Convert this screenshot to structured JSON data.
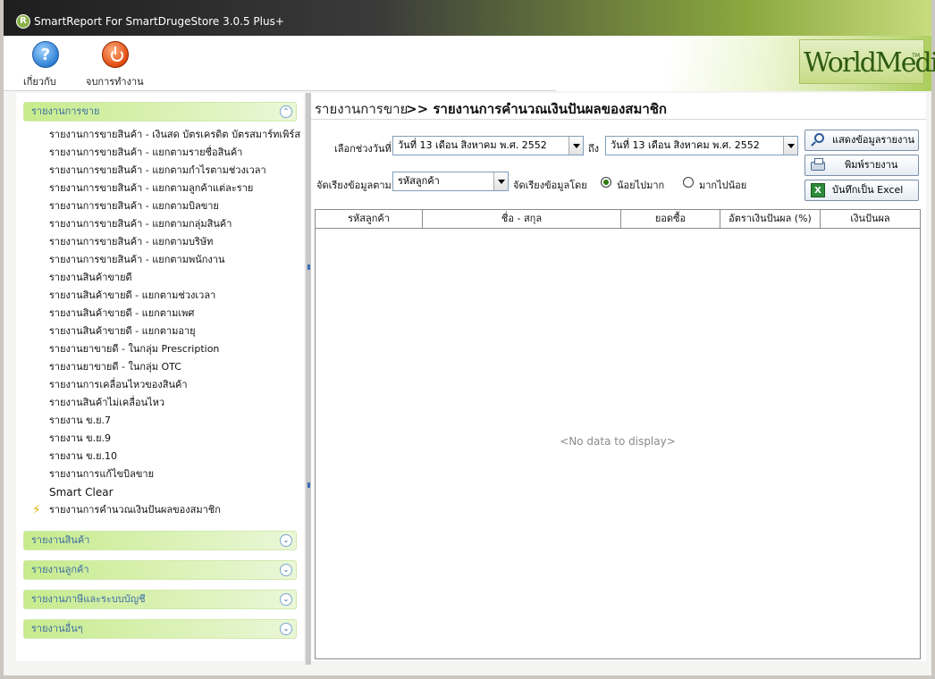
{
  "window": {
    "title": "SmartReport For SmartDrugeStore 3.0.5 Plus+",
    "app_icon": "R"
  },
  "toolbar": {
    "about_label": "เกี่ยวกับ",
    "exit_label": "จบการทำงาน",
    "brand": "WorldMedic",
    "brand_tm": "TM"
  },
  "sidebar": {
    "sales_group": "รายงานการขาย",
    "items": [
      "รายงานการขายสินค้า - เงินสด บัตรเครดิต บัตรสมาร์ทเพิร์ส",
      "รายงานการขายสินค้า - แยกตามรายชื่อสินค้า",
      "รายงานการขายสินค้า - แยกตามกำไรตามช่วงเวลา",
      "รายงานการขายสินค้า - แยกตามลูกค้าแต่ละราย",
      "รายงานการขายสินค้า - แยกตามบิลขาย",
      "รายงานการขายสินค้า - แยกตามกลุ่มสินค้า",
      "รายงานการขายสินค้า - แยกตามบริษัท",
      "รายงานการขายสินค้า - แยกตามพนักงาน",
      "รายงานสินค้าขายดี",
      "รายงานสินค้าขายดี - แยกตามช่วงเวลา",
      "รายงานสินค้าขายดี - แยกตามเพศ",
      "รายงานสินค้าขายดี - แยกตามอายุ",
      "รายงานยาขายดี - ในกลุ่ม Prescription",
      "รายงานยาขายดี - ในกลุ่ม OTC",
      "รายงานการเคลื่อนไหวของสินค้า",
      "รายงานสินค้าไม่เคลื่อนไหว",
      "รายงาน ข.ย.7",
      "รายงาน ข.ย.9",
      "รายงาน ข.ย.10",
      "รายงานการแก้ไขบิลขาย",
      "Smart Clear",
      "รายงานการคำนวณเงินปันผลของสมาชิก"
    ],
    "other_groups": [
      "รายงานสินค้า",
      "รายงานลูกค้า",
      "รายงานภาษีและระบบบัญชี",
      "รายงานอื่นๆ"
    ]
  },
  "main": {
    "breadcrumb_parent": "รายงานการขาย",
    "breadcrumb_current": ">> รายงานการคำนวณเงินปันผลของสมาชิก",
    "filters": {
      "date_range_label": "เลือกช่วงวันที่",
      "date_from": "วันที่ 13 เดือน  สิงหาคม  พ.ศ.  2552",
      "to_label": "ถึง",
      "date_to": "วันที่ 13 เดือน  สิงหาคม  พ.ศ.  2552",
      "sort_field_label": "จัดเรียงข้อมูลตาม",
      "sort_field": "รหัสลูกค้า",
      "sort_order_label": "จัดเรียงข้อมูลโดย",
      "asc_label": "น้อยไปมาก",
      "desc_label": "มากไปน้อย"
    },
    "buttons": {
      "show_report": "แสดงข้อมูลรายงาน",
      "print_report": "พิมพ์รายงาน",
      "save_excel": "บันทึกเป็น Excel"
    },
    "grid": {
      "columns": [
        "รหัสลูกค้า",
        "ชื่อ - สกุล",
        "ยอดซื้อ",
        "อัตราเงินปันผล (%)",
        "เงินปันผล"
      ],
      "empty_text": "<No data to display>"
    }
  }
}
